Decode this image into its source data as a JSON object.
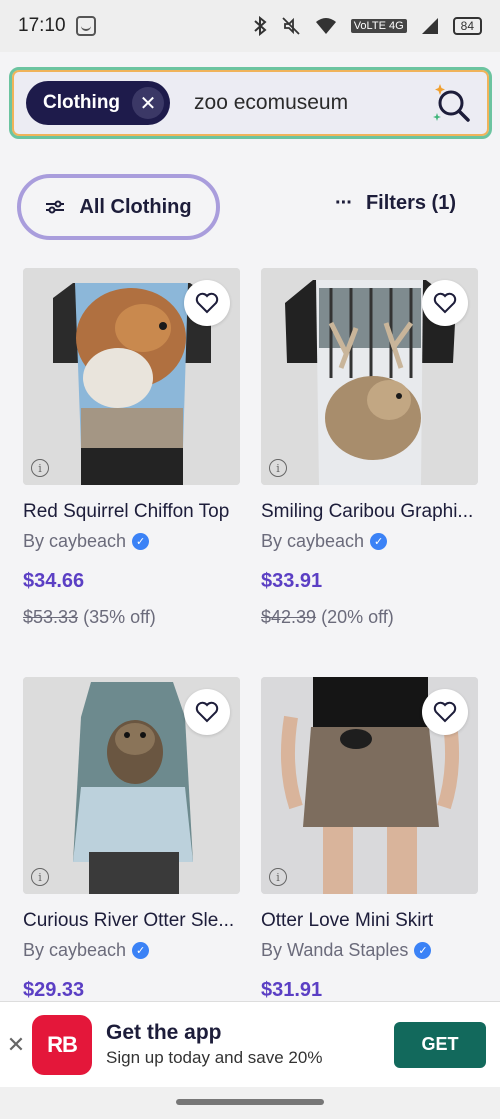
{
  "status_bar": {
    "time": "17:10",
    "battery": "84",
    "network": "VoLTE 4G"
  },
  "search": {
    "chip_label": "Clothing",
    "query": "zoo ecomuseum"
  },
  "filters": {
    "all_label": "All Clothing",
    "filters_label": "Filters (1)"
  },
  "products": [
    {
      "title": "Red Squirrel Chiffon Top",
      "by": "By caybeach",
      "price": "$34.66",
      "was": "$53.33",
      "discount": "(35% off)"
    },
    {
      "title": "Smiling Caribou Graphi...",
      "by": "By caybeach",
      "price": "$33.91",
      "was": "$42.39",
      "discount": "(20% off)"
    },
    {
      "title": "Curious River Otter Sle...",
      "by": "By caybeach",
      "price": "$29.33"
    },
    {
      "title": "Otter Love Mini Skirt",
      "by": "By Wanda Staples",
      "price": "$31.91"
    }
  ],
  "banner": {
    "logo": "RB",
    "title": "Get the app",
    "subtitle": "Sign up today and save 20%",
    "button": "GET"
  },
  "colors": {
    "accent_purple": "#5b3fc4",
    "chip_navy": "#1e1b4b",
    "get_green": "#12695c",
    "brand_red": "#e4173a"
  }
}
